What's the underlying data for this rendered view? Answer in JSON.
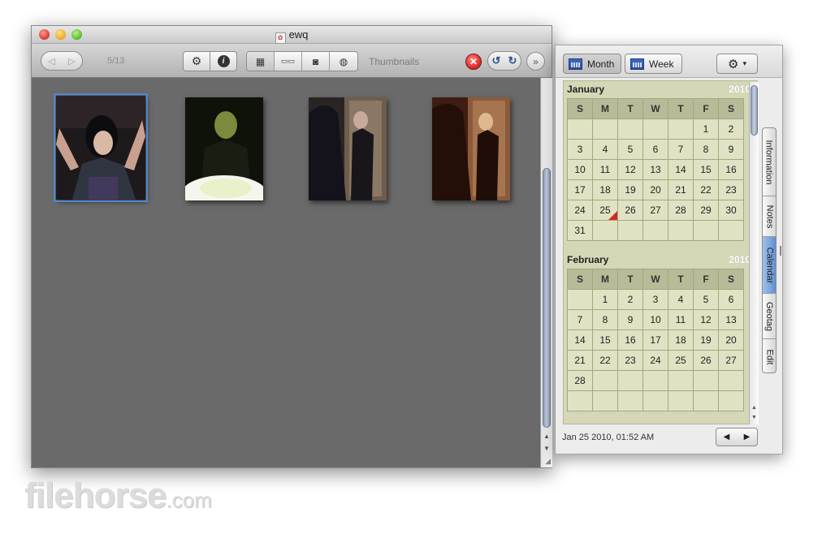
{
  "main_window": {
    "title": "ewq",
    "toolbar": {
      "back_icon": "◁",
      "forward_icon": "▷",
      "counter": "5/13",
      "gear_icon": "⚙",
      "info_icon": "i",
      "view_grid_icon": "▦",
      "view_filmstrip_icon": "▭▭",
      "view_single_icon": "◙",
      "view_map_icon": "◍",
      "view_label": "Thumbnails",
      "stop_icon": "✕",
      "rotate_left_icon": "↺",
      "rotate_right_icon": "↻",
      "more_icon": "»"
    },
    "scroll_up_icon": "▲",
    "scroll_down_icon": "▼"
  },
  "inspector": {
    "toolbar": {
      "month_label": "Month",
      "week_label": "Week",
      "gear_icon": "⚙",
      "dropdown_icon": "▾"
    },
    "calendar": {
      "weekdays": [
        "S",
        "M",
        "T",
        "W",
        "T",
        "F",
        "S"
      ],
      "months": [
        {
          "name": "January",
          "year": "2010",
          "weeks": [
            [
              "",
              "",
              "",
              "",
              "",
              "1",
              "2"
            ],
            [
              "3",
              "4",
              "5",
              "6",
              "7",
              "8",
              "9"
            ],
            [
              "10",
              "11",
              "12",
              "13",
              "14",
              "15",
              "16"
            ],
            [
              "17",
              "18",
              "19",
              "20",
              "21",
              "22",
              "23"
            ],
            [
              "24",
              "25",
              "26",
              "27",
              "28",
              "29",
              "30"
            ],
            [
              "31",
              "",
              "",
              "",
              "",
              "",
              ""
            ]
          ],
          "marked_day": "25"
        },
        {
          "name": "February",
          "year": "2010",
          "weeks": [
            [
              "",
              "1",
              "2",
              "3",
              "4",
              "5",
              "6"
            ],
            [
              "7",
              "8",
              "9",
              "10",
              "11",
              "12",
              "13"
            ],
            [
              "14",
              "15",
              "16",
              "17",
              "18",
              "19",
              "20"
            ],
            [
              "21",
              "22",
              "23",
              "24",
              "25",
              "26",
              "27"
            ],
            [
              "28",
              "",
              "",
              "",
              "",
              "",
              ""
            ],
            [
              "",
              "",
              "",
              "",
              "",
              "",
              ""
            ]
          ],
          "marked_day": ""
        }
      ]
    },
    "tabs": [
      "Information",
      "Notes",
      "Calendar",
      "Geotag",
      "Edit"
    ],
    "active_tab": "Calendar",
    "status_text": "Jan 25 2010, 01:52 AM",
    "prev_icon": "◀",
    "next_icon": "▶"
  },
  "watermark": {
    "text": "filehorse",
    "suffix": ".com"
  },
  "colors": {
    "selection": "#4e87d6",
    "calendar_bg": "#d5d7b6",
    "marker": "#cf2a20",
    "active_tab": "#5f8fd0"
  }
}
